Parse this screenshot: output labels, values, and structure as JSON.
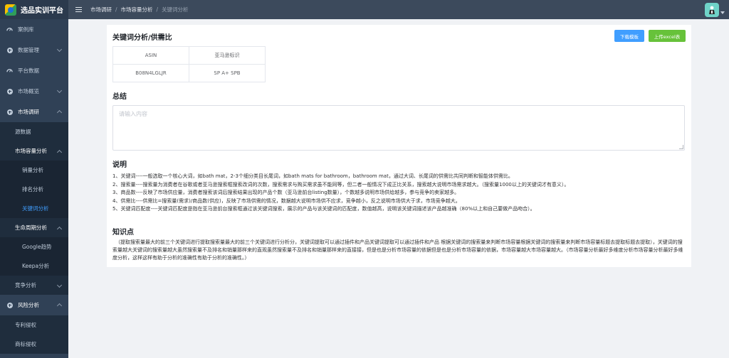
{
  "brand": {
    "title": "选品实训平台"
  },
  "sidebar": {
    "items": [
      {
        "label": "案例库"
      },
      {
        "label": "数据管理"
      },
      {
        "label": "平台数据"
      },
      {
        "label": "市场概览"
      },
      {
        "label": "市场调研"
      },
      {
        "label": "源数据"
      },
      {
        "label": "市场容量分析"
      },
      {
        "label": "销量分析"
      },
      {
        "label": "排名分析"
      },
      {
        "label": "关键词分析"
      },
      {
        "label": "生命周期分析"
      },
      {
        "label": "Google趋势"
      },
      {
        "label": "Keepa分析"
      },
      {
        "label": "竞争分析"
      },
      {
        "label": "风险分析"
      },
      {
        "label": "专利侵权"
      },
      {
        "label": "商标侵权"
      }
    ]
  },
  "header": {
    "breadcrumb": [
      "市场调研",
      "市场容量分析",
      "关键词分析"
    ]
  },
  "main": {
    "title": "关键词分析/供需比",
    "download_label": "下载模板",
    "upload_label": "上传excel表",
    "table": {
      "headers": [
        "ASIN",
        "亚马逊标识"
      ],
      "rows": [
        [
          "B08N4LGLJR",
          "SP A+ SPB"
        ]
      ]
    },
    "summary_heading": "总结",
    "summary_placeholder": "请输入内容",
    "notes_heading": "说明",
    "notes": [
      "1、关键词----一般选取一个核心大词，如bath mat，2-3个细分类目长尾词，如bath mats for bathroom，bathroom mat，通过大词、长尾词的供需比共同判断和智能体供需比。",
      "2、搜索量----搜索量为消费者在谷歌或者亚马逊搜索框搜索改词的次数，搜索需求与购买需求虽不能同等，但二者一般情况下成正比关系，搜索越大说明市场需求越大。（搜索量1000以上的关键词才有意义）。",
      "3、商品数----反映了市场供应量，消费者搜索该词后搜索结果出现的产品个数（亚马逊前台listing数量），个数越多说明市场供给越多，参与竞争的卖家越多。",
      "4、供需比----供需比=搜索量(需求)/商品数(供应)，反映了市场供需的情况，数据越大说明市场供不应求，竞争越小，反之说明市场供大于求，市场竞争越大。",
      "5、关键词匹配度----关键词匹配度是指在亚马逊前台搜索框通过该关键词搜索，展示的产品与该关键词的匹配度，数值越高，说明该关键词描述该产品越准确（80%以上和自己要做产品吻合）。"
    ],
    "knowledge_heading": "知识点",
    "knowledge_text": "（提取搜索量最大的前三个关键词进行提取搜索量最大的前三个关键词进行分析分，关键词提取可以通过插件和产品关键词提取可以通过插件和产品 根据关键词的搜索量来判断市场容量根据关键词的搜索量来判断市场容量标题去提取标题去提取），关键词的搜索量越大关键词的搜索量越大虽然搜索量不及排名和销量那样来的直观虽然搜索量不及排名和销量那样来的直接接，但是也是分析市场容量的依据但是也是分析市场容量的依据，市场容量越大市场容量越大。（市场容量分析最好多维度分析市场容量分析最好多维度分析，这样这样有助于分析的准确性有助于分析的准确性。）"
  }
}
